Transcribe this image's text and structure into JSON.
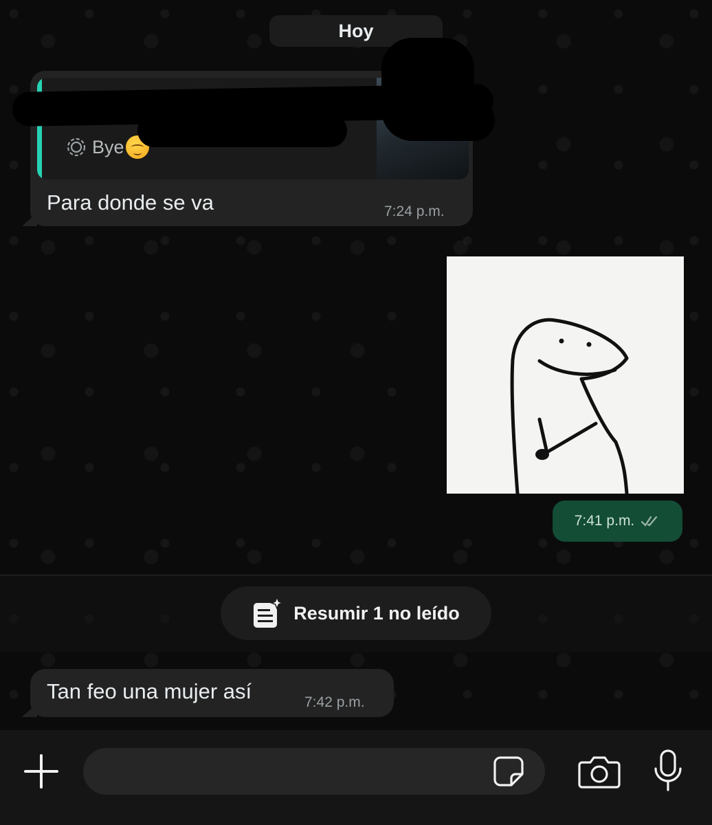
{
  "chat": {
    "date_label": "Hoy",
    "messages": [
      {
        "direction": "incoming",
        "reply_quote": {
          "status_text": "Bye"
        },
        "text": "Para donde se va",
        "time": "7:24 p.m."
      },
      {
        "direction": "outgoing",
        "type": "sticker",
        "time": "7:41 p.m.",
        "read_status": "read-double-check"
      },
      {
        "direction": "incoming",
        "text": "Tan feo una mujer así",
        "time": "7:42 p.m."
      }
    ],
    "summarize_button": {
      "label": "Resumir 1 no leído"
    }
  },
  "composer": {
    "input_value": "",
    "placeholder": "",
    "icons": [
      "plus-icon",
      "sticker-icon",
      "camera-icon",
      "microphone-icon"
    ]
  },
  "colors": {
    "background": "#0b0b0b",
    "incoming_bubble": "#232323",
    "outgoing_bubble": "#134d36",
    "quote_accent": "#25d3b4"
  }
}
